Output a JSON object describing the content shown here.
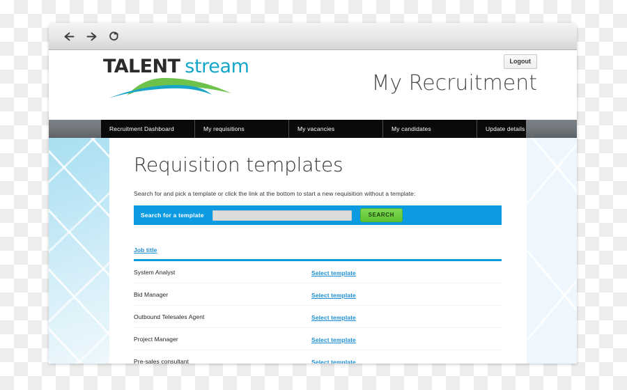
{
  "browser": {
    "back_icon": "arrow-left-icon",
    "forward_icon": "arrow-right-icon",
    "reload_icon": "reload-icon"
  },
  "site_header": {
    "logo_primary": "TALENT",
    "logo_secondary": "stream",
    "logout_label": "Logout",
    "page_title": "My Recruitment",
    "colors": {
      "logo_primary": "#2b2b2b",
      "logo_secondary": "#14a6c8",
      "swoosh_green": "#6cc24a",
      "swoosh_teal": "#1aa5c8"
    }
  },
  "nav": {
    "tabs": [
      {
        "label": "Recruitment Dashboard"
      },
      {
        "label": "My requisitions"
      },
      {
        "label": "My vacancies"
      },
      {
        "label": "My candidates"
      },
      {
        "label": "Update details"
      }
    ]
  },
  "main": {
    "heading": "Requisition templates",
    "intro": "Search for and pick a template or click the link at the bottom to start a new requisition without a template:",
    "search": {
      "label": "Search for a template",
      "value": "",
      "placeholder": "",
      "button_label": "SEARCH",
      "bar_color": "#0c9ae0",
      "button_color": "#5cc22e"
    },
    "table": {
      "columns": [
        "Job title"
      ],
      "action_label": "Select template",
      "rows": [
        {
          "job_title": "System Analyst",
          "action": "Select template"
        },
        {
          "job_title": "Bid Manager",
          "action": "Select template"
        },
        {
          "job_title": "Outbound Telesales Agent",
          "action": "Select template"
        },
        {
          "job_title": "Project Manager",
          "action": "Select template"
        },
        {
          "job_title": "Pre-sales consultant",
          "action": "Select template"
        }
      ]
    }
  }
}
